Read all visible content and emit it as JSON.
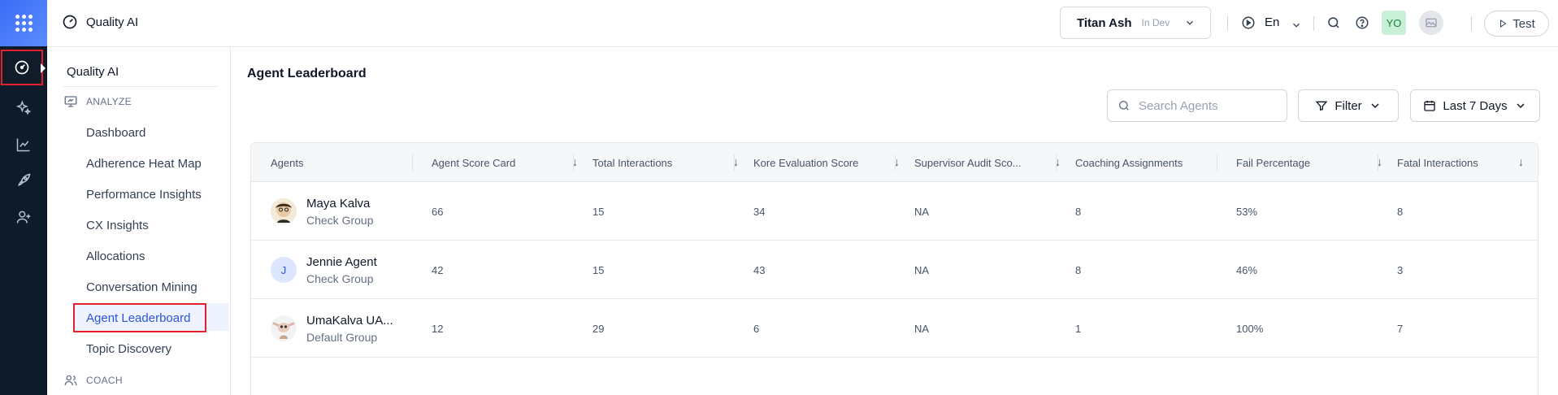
{
  "header": {
    "app_title": "Quality AI",
    "project_name": "Titan Ash",
    "project_env": "In Dev",
    "language": "En",
    "avatar_initials": "YO",
    "test_label": "Test"
  },
  "rail": {
    "items": [
      {
        "icon": "gauge-icon"
      },
      {
        "icon": "sparkles-icon"
      },
      {
        "icon": "line-chart-icon"
      },
      {
        "icon": "rocket-icon"
      },
      {
        "icon": "user-plus-icon"
      }
    ]
  },
  "sidebar": {
    "title": "Quality AI",
    "section_analyze": "ANALYZE",
    "items": [
      "Dashboard",
      "Adherence Heat Map",
      "Performance Insights",
      "CX Insights",
      "Allocations",
      "Conversation Mining",
      "Agent Leaderboard",
      "Topic Discovery"
    ],
    "active_item": "Agent Leaderboard",
    "section_coach": "COACH"
  },
  "main": {
    "title": "Agent Leaderboard",
    "search_placeholder": "Search Agents",
    "filter_label": "Filter",
    "date_range": "Last 7 Days"
  },
  "table": {
    "columns": [
      "Agents",
      "Agent Score Card",
      "Total Interactions",
      "Kore Evaluation Score",
      "Supervisor Audit Sco...",
      "Coaching Assignments",
      "Fail Percentage",
      "Fatal Interactions"
    ],
    "sort_glyph": "↓",
    "rows": [
      {
        "name": "Maya Kalva",
        "group": "Check Group",
        "avatar": "",
        "cells": [
          "66",
          "15",
          "34",
          "NA",
          "8",
          "53%",
          "8"
        ]
      },
      {
        "name": "Jennie Agent",
        "group": "Check Group",
        "avatar": "J",
        "cells": [
          "42",
          "15",
          "43",
          "NA",
          "8",
          "46%",
          "3"
        ]
      },
      {
        "name": "UmaKalva UA...",
        "group": "Default Group",
        "avatar": "",
        "cells": [
          "12",
          "29",
          "6",
          "NA",
          "1",
          "100%",
          "7"
        ]
      }
    ]
  },
  "colors": {
    "accent": "#2b54d8",
    "rail_bg": "#0d1b2a",
    "highlight_box": "#e4202c"
  }
}
